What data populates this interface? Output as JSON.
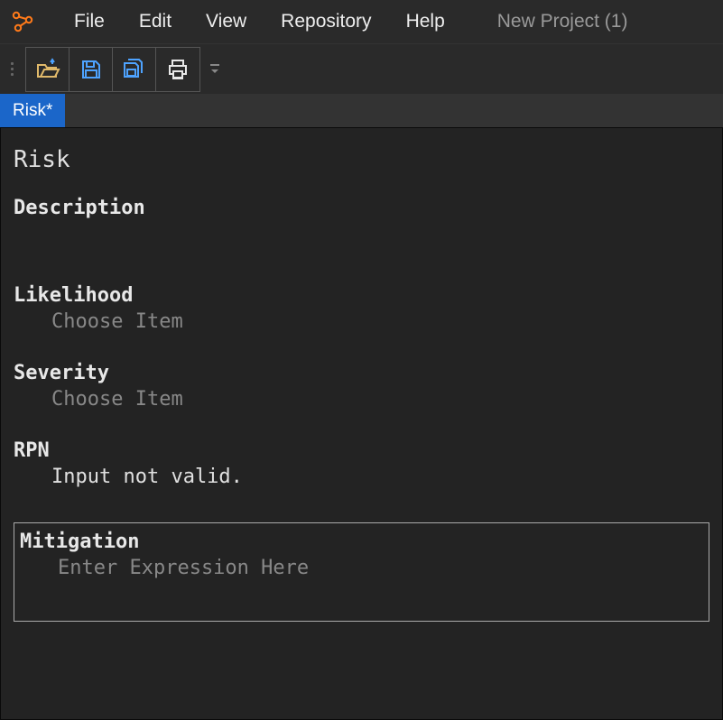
{
  "menubar": {
    "items": [
      "File",
      "Edit",
      "View",
      "Repository",
      "Help"
    ],
    "project_label": "New Project (1)"
  },
  "toolbar": {
    "open_title": "Open",
    "save_title": "Save",
    "save_all_title": "Save All",
    "print_title": "Print"
  },
  "tab": {
    "label": "Risk*"
  },
  "form": {
    "title": "Risk",
    "description_label": "Description",
    "likelihood_label": "Likelihood",
    "likelihood_value": "Choose Item",
    "severity_label": "Severity",
    "severity_value": "Choose Item",
    "rpn_label": "RPN",
    "rpn_value": "Input not valid.",
    "mitigation_label": "Mitigation",
    "mitigation_placeholder": "Enter Expression Here"
  }
}
